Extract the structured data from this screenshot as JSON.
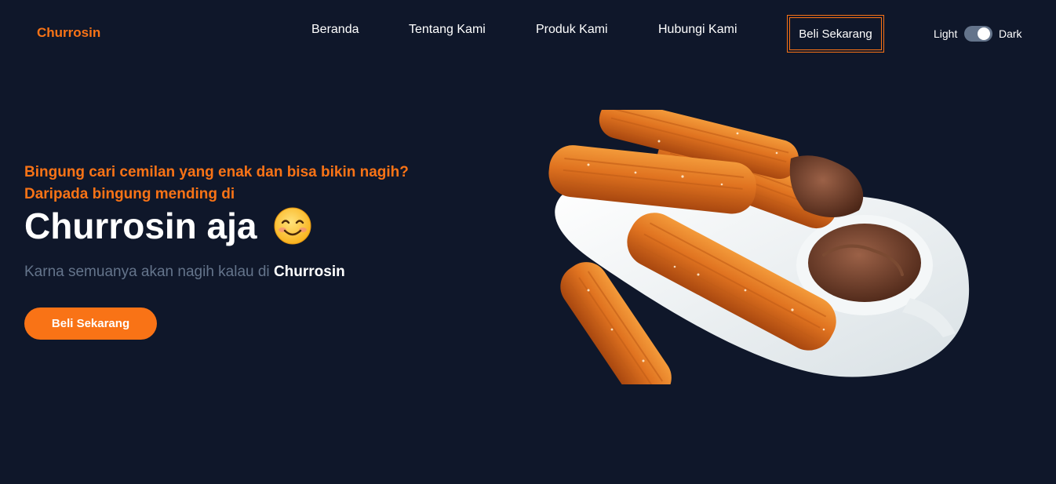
{
  "nav": {
    "brand": "Churrosin",
    "links": [
      "Beranda",
      "Tentang Kami",
      "Produk Kami",
      "Hubungi Kami"
    ],
    "cta": "Beli Sekarang",
    "theme": {
      "light": "Light",
      "dark": "Dark",
      "dark_enabled": true
    }
  },
  "hero": {
    "tagline_1": "Bingung cari cemilan yang enak dan bisa bikin nagih?",
    "tagline_2": "Daripada bingung mending di",
    "title": "Churrosin aja",
    "title_icon": "smiling-face-emoji",
    "subtitle_text": "Karna semuanya akan nagih kalau di ",
    "subtitle_brand": "Churrosin",
    "button": "Beli Sekarang",
    "image_icon": "churros-with-chocolate-dip"
  },
  "colors": {
    "background": "#0f172a",
    "accent": "#f97316",
    "muted_text": "#64748b",
    "text": "#ffffff"
  }
}
